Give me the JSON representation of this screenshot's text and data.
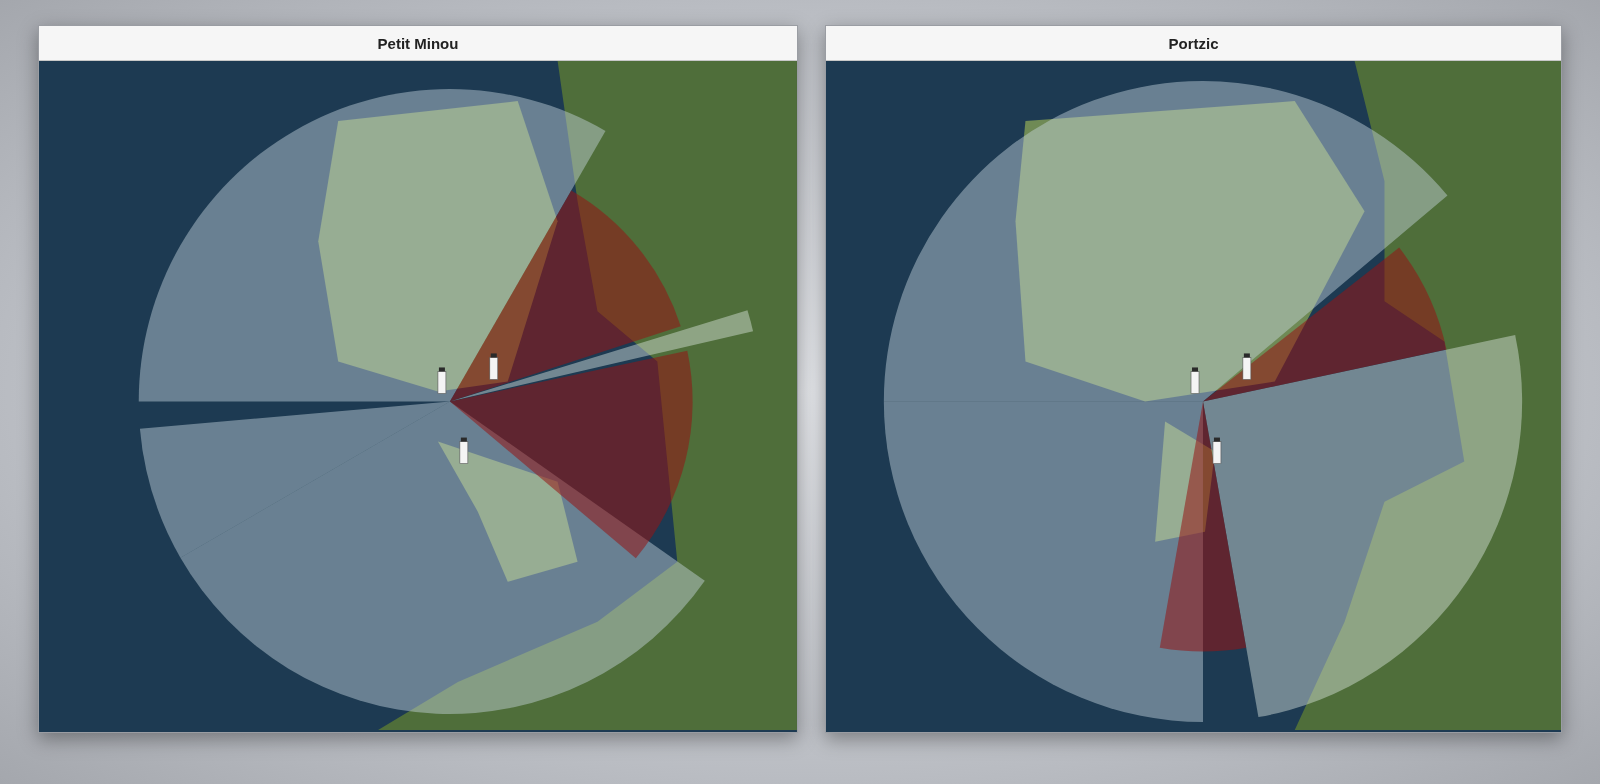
{
  "windows": [
    {
      "title": "Petit Minou"
    },
    {
      "title": "Portzic"
    }
  ]
}
